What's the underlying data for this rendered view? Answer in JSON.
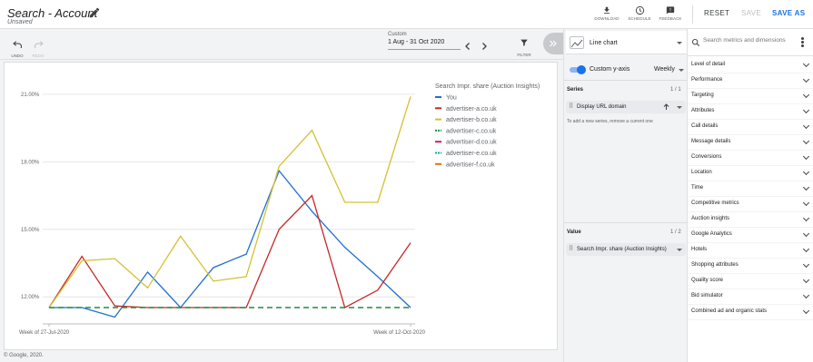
{
  "header": {
    "title": "Search - Account",
    "subtitle": "Unsaved",
    "buttons": {
      "download": "DOWNLOAD",
      "schedule": "SCHEDULE",
      "feedback": "FEEDBACK"
    },
    "reset": "RESET",
    "save": "SAVE",
    "save_as": "SAVE AS"
  },
  "toolbar": {
    "undo": "UNDO",
    "redo": "REDO",
    "date_label": "Custom",
    "date_value": "1 Aug - 31 Oct 2020",
    "filter": "FILTER"
  },
  "footer": "© Google, 2020.",
  "config": {
    "chart_type": "Line chart",
    "custom_y_axis": "Custom y-axis",
    "granularity": "Weekly",
    "series_title": "Series",
    "series_count": "1 / 1",
    "series_chip": "Display URL domain",
    "series_hint": "To add a new series, remove a current one",
    "value_title": "Value",
    "value_count": "1 / 2",
    "value_chip": "Search Impr. share (Auction Insights)"
  },
  "metrics": {
    "search_placeholder": "Search metrics and dimensions",
    "items": [
      "Level of detail",
      "Performance",
      "Targeting",
      "Attributes",
      "Call details",
      "Message details",
      "Conversions",
      "Location",
      "Time",
      "Competitive metrics",
      "Auction insights",
      "Google Analytics",
      "Hotels",
      "Shopping attributes",
      "Quality score",
      "Bid simulator",
      "Combined ad and organic stats"
    ]
  },
  "colors": {
    "accent": "#1a73e8",
    "series": [
      "#1f6fd1",
      "#c62828",
      "#d4c033",
      "#1e8e3e",
      "#d81b60",
      "#12a3a3",
      "#e8710a"
    ]
  },
  "chart_data": {
    "type": "line",
    "legend_title": "Search Impr. share (Auction Insights)",
    "legend_placement": "top-right",
    "y_tick_labels": [
      "21.00%",
      "18.00%",
      "15.00%",
      "12.00%"
    ],
    "y_ticks": [
      21,
      18,
      15,
      12
    ],
    "ylim": [
      10.8,
      21.6
    ],
    "x_tick_labels": [
      "Week of 27-Jul-2020",
      "Week of 12-Oct-2020"
    ],
    "x_count": 12,
    "grid": true,
    "series": [
      {
        "name": "You",
        "color": "#1f6fd1",
        "dash": false,
        "values": [
          10,
          10,
          11.1,
          13.1,
          10.5,
          13.3,
          13.9,
          17.6,
          15.8,
          14.2,
          12.9,
          10
        ]
      },
      {
        "name": "advertiser-a.co.uk",
        "color": "#c62828",
        "dash": false,
        "values": [
          10,
          13.8,
          11.6,
          10,
          10,
          10,
          10.6,
          15.0,
          16.5,
          10.1,
          12.3,
          14.4
        ]
      },
      {
        "name": "advertiser-b.co.uk",
        "color": "#d4c033",
        "dash": false,
        "values": [
          10,
          13.6,
          13.7,
          12.4,
          14.7,
          12.7,
          12.9,
          17.8,
          19.4,
          16.2,
          16.2,
          20.9
        ]
      },
      {
        "name": "advertiser-c.co.uk",
        "color": "#1e8e3e",
        "dash": true,
        "values": [
          10,
          10,
          10,
          10,
          10,
          10,
          10,
          10,
          10,
          10,
          10,
          10
        ]
      },
      {
        "name": "advertiser-d.co.uk",
        "color": "#d81b60",
        "dash": false,
        "values": []
      },
      {
        "name": "advertiser-e.co.uk",
        "color": "#12a3a3",
        "dash": true,
        "values": []
      },
      {
        "name": "advertiser-f.co.uk",
        "color": "#e8710a",
        "dash": false,
        "values": []
      }
    ]
  }
}
